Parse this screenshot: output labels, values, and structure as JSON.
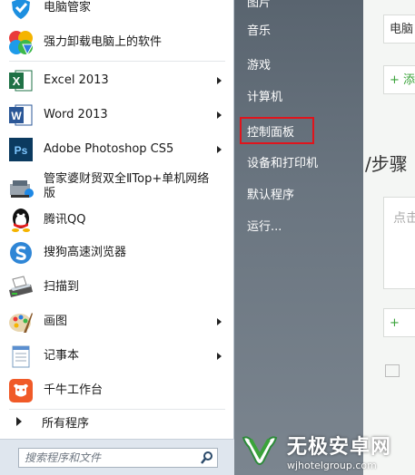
{
  "start_menu": {
    "programs": [
      {
        "label": "电脑管家",
        "icon": "shield-icon",
        "has_submenu": false
      },
      {
        "label": "强力卸载电脑上的软件",
        "icon": "uninstall-icon",
        "has_submenu": false
      },
      {
        "label": "Excel 2013",
        "icon": "excel-icon",
        "has_submenu": true
      },
      {
        "label": "Word 2013",
        "icon": "word-icon",
        "has_submenu": true
      },
      {
        "label": "Adobe Photoshop CS5",
        "icon": "photoshop-icon",
        "has_submenu": true
      },
      {
        "label": "管家婆财贸双全ⅡTop+单机网络版",
        "icon": "installer-icon",
        "has_submenu": false
      },
      {
        "label": "腾讯QQ",
        "icon": "qq-icon",
        "has_submenu": false
      },
      {
        "label": "搜狗高速浏览器",
        "icon": "sogou-browser-icon",
        "has_submenu": false
      },
      {
        "label": "扫描到",
        "icon": "scanner-icon",
        "has_submenu": false
      },
      {
        "label": "画图",
        "icon": "paint-icon",
        "has_submenu": true
      },
      {
        "label": "记事本",
        "icon": "notepad-icon",
        "has_submenu": true
      },
      {
        "label": "千牛工作台",
        "icon": "qianniu-icon",
        "has_submenu": false
      }
    ],
    "all_programs_label": "所有程序",
    "search_placeholder": "搜索程序和文件",
    "right_items": [
      "图片",
      "音乐",
      "游戏",
      "计算机",
      "控制面板",
      "设备和打印机",
      "默认程序",
      "运行..."
    ],
    "highlighted_item": "控制面板",
    "highlight_color": "#e0141c"
  },
  "background_app": {
    "field_text": "电脑",
    "add_button_1": "+ 添",
    "step_text": "/步骤",
    "textarea_placeholder": "点击",
    "add_button_2": "+"
  },
  "watermark": {
    "name": "无极安卓网",
    "url": "wjhotelgroup.com"
  }
}
